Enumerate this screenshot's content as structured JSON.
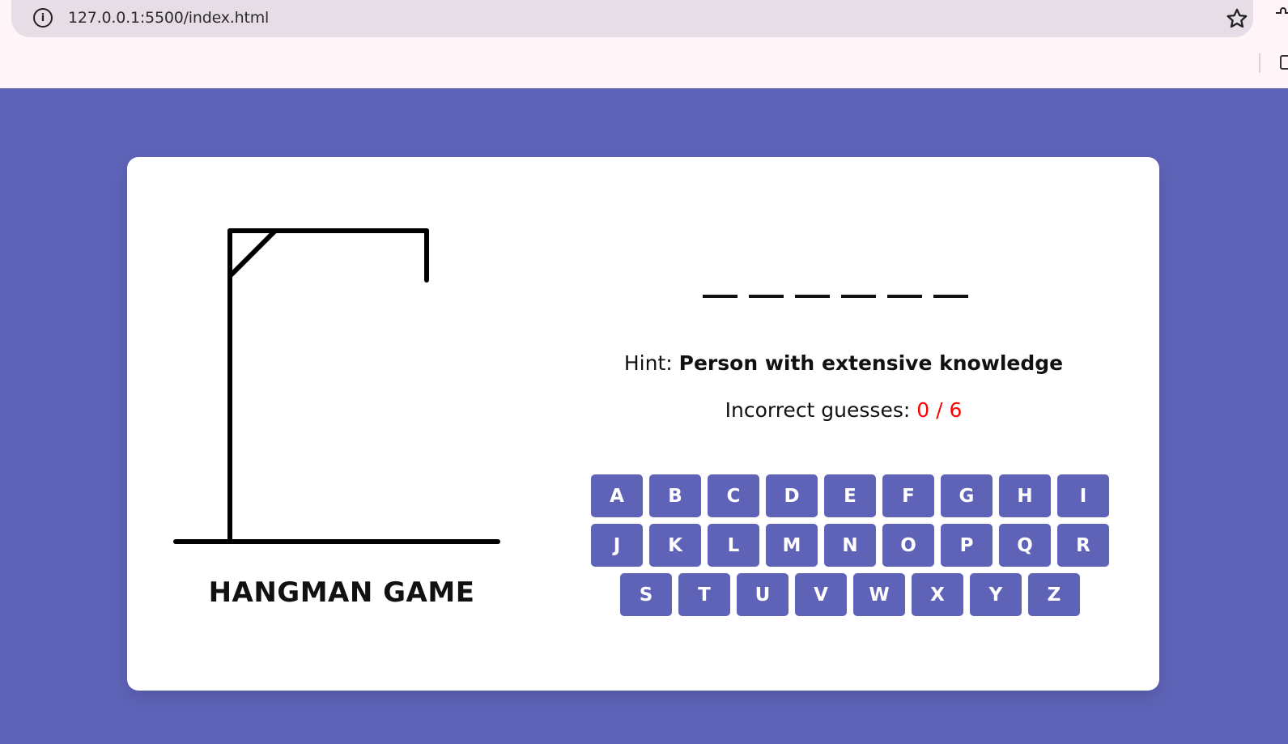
{
  "browser": {
    "url": "127.0.0.1:5500/index.html",
    "info_glyph": "i"
  },
  "game": {
    "title": "HANGMAN GAME",
    "word_slots": 6,
    "hint_label": "Hint:",
    "hint_text": "Person with extensive knowledge",
    "guesses_label": "Incorrect guesses:",
    "guesses_count": "0 / 6",
    "incorrect_guesses": 0,
    "max_guesses": 6
  },
  "keyboard": {
    "rows": [
      [
        "A",
        "B",
        "C",
        "D",
        "E",
        "F",
        "G",
        "H",
        "I"
      ],
      [
        "J",
        "K",
        "L",
        "M",
        "N",
        "O",
        "P",
        "Q",
        "R"
      ],
      [
        "S",
        "T",
        "U",
        "V",
        "W",
        "X",
        "Y",
        "Z"
      ]
    ]
  },
  "colors": {
    "background": "#5e63b8",
    "key": "#5e63b8",
    "count": "#ff0000"
  }
}
